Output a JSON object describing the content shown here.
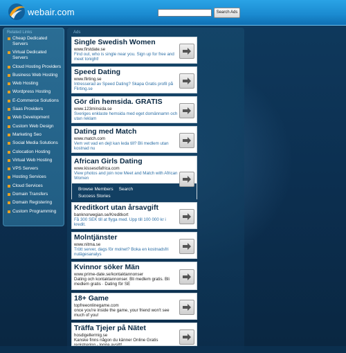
{
  "header": {
    "site": "webair.com",
    "search_placeholder": "",
    "search_button": "Search Ads"
  },
  "sidebar": {
    "title": "Related Links",
    "items": [
      "Cheap Dedicated Servers",
      "Virtual Dedicated Servers",
      "Cloud Hosting Providers",
      "Business Web Hosting",
      "Web Hosting",
      "Wordpress Hosting",
      "E-Commerce Solutions",
      "Saas Providers",
      "Web Development",
      "Custom Web Design",
      "Marketing Seo",
      "Social Media Solutions",
      "Colocation Hosting",
      "Virtual Web Hosting",
      "VPS Servers",
      "Hosting Services",
      "Cloud Services",
      "Domain Transfers",
      "Domain Registering",
      "Custom Programming"
    ]
  },
  "main": {
    "ads_label": "Ads",
    "ads": [
      {
        "title": "Single Swedish Women",
        "url": "www.firstdate.se",
        "desc": "Find out, who is single near you. Sign up for free and meet tonight!"
      },
      {
        "title": "Speed Dating",
        "url": "www.flirting.se",
        "desc": "Intresserad av Speed Dating? Skapa Gratis profil på Flirting.se"
      },
      {
        "title": "Gör din hemsida. GRATIS",
        "url": "www.123minsida.se",
        "desc": "Sveriges enklaste hemsida med eget domännamn och utan reklam"
      },
      {
        "title": "Dating med Match",
        "url": "www.match.com",
        "desc": "Vem vet vad en dejt kan leda till? Bli medlem utan kostnad nu"
      },
      {
        "title": "African Girls Dating",
        "url": "www.kissesofafrica.com",
        "desc": "View photos and join now Meet and Match with African Women",
        "links": [
          "Browse Members",
          "Search",
          "Success Stories"
        ]
      },
      {
        "title": "Kreditkort utan årsavgift",
        "url": "banknorwegian.se/Kreditkort",
        "desc": "Få 300 SEK till at flyga med. Upp till 100 000 kr i kredit."
      },
      {
        "title": "Molntjänster",
        "url": "www.nitma.se",
        "desc": "Trött server, dags för molnet? Boka en kostnadsfri nulägesanalys"
      },
      {
        "title": "Kvinnor söker Män",
        "url": "www.prime-date.se/kontaktannonser",
        "desc": "Dating och kontaktannonser. Bli medlem gratis. Bli medlem gratis · Dating för SE"
      },
      {
        "title": "18+ Game",
        "url": "topfreeonlinegame.com",
        "desc": "once you're inside the game, your friend won't see much of you!"
      },
      {
        "title": "Träffa Tjejer på Nätet",
        "url": "hosdigellermig.se",
        "desc": "Kanske finns någon du känner Online Gratis registrering - logga avsitt!"
      }
    ]
  }
}
